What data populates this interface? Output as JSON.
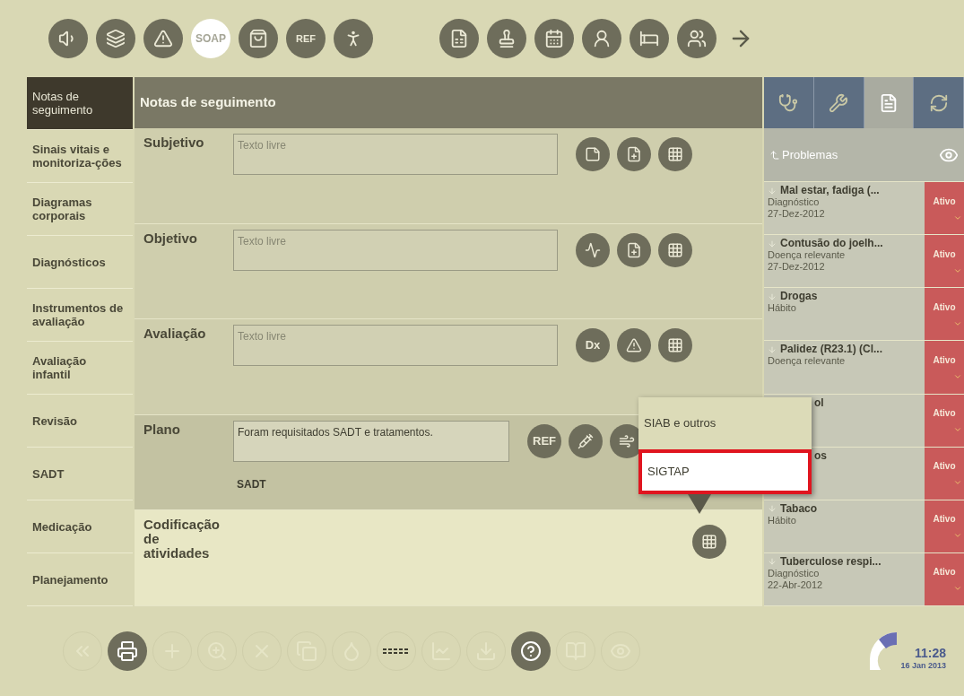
{
  "top_toolbar": [
    {
      "kind": "speaker",
      "selected": false
    },
    {
      "kind": "cards",
      "selected": false
    },
    {
      "kind": "warning",
      "selected": false
    },
    {
      "kind": "text",
      "label": "SOAP",
      "selected": true
    },
    {
      "kind": "bag",
      "selected": false
    },
    {
      "kind": "ref",
      "label": "REF",
      "selected": false
    },
    {
      "kind": "walker",
      "selected": false
    },
    {
      "kind": "gap"
    },
    {
      "kind": "sheet",
      "selected": false
    },
    {
      "kind": "stamp",
      "selected": false
    },
    {
      "kind": "calendar",
      "selected": false
    },
    {
      "kind": "nurse",
      "selected": false
    },
    {
      "kind": "bed",
      "selected": false
    },
    {
      "kind": "family",
      "selected": false
    },
    {
      "kind": "arrow"
    }
  ],
  "sidebar": {
    "items": [
      {
        "label": "Notas de seguimento",
        "selected": true
      },
      {
        "label": "Sinais vitais e monitoriza-ções",
        "selected": false
      },
      {
        "label": "Diagramas corporais",
        "selected": false
      },
      {
        "label": "Diagnósticos",
        "selected": false
      },
      {
        "label": "Instrumentos de avaliação",
        "selected": false
      },
      {
        "label": "Avaliação infantil",
        "selected": false
      },
      {
        "label": "Revisão",
        "selected": false
      },
      {
        "label": "SADT",
        "selected": false
      },
      {
        "label": "Medicação",
        "selected": false
      },
      {
        "label": "Planejamento",
        "selected": false
      }
    ]
  },
  "main": {
    "title": "Notas de seguimento",
    "sections": [
      {
        "label": "Subjetivo",
        "kind": "text",
        "field": {
          "placeholder": "Texto livre"
        },
        "actions": [
          {
            "kind": "note-plus"
          },
          {
            "kind": "file-plus"
          },
          {
            "kind": "grid-plus"
          }
        ]
      },
      {
        "label": "Objetivo",
        "kind": "text",
        "field": {
          "placeholder": "Texto livre"
        },
        "actions": [
          {
            "kind": "pulse-plus"
          },
          {
            "kind": "file-plus"
          },
          {
            "kind": "grid-plus"
          }
        ]
      },
      {
        "label": "Avaliação",
        "kind": "text",
        "field": {
          "placeholder": "Texto livre"
        },
        "actions": [
          {
            "kind": "label",
            "label": "Dx"
          },
          {
            "kind": "warning-plus"
          },
          {
            "kind": "grid-plus"
          }
        ]
      },
      {
        "label": "Plano",
        "kind": "plan",
        "field": {
          "value": "Foram requisitados SADT e tratamentos."
        },
        "note": "SADT",
        "actions": [
          {
            "kind": "ref",
            "label": "REF"
          },
          {
            "kind": "syringe-plus"
          },
          {
            "kind": "lungs"
          }
        ]
      },
      {
        "label": "Codificação de atividades",
        "kind": "coding",
        "actions": [
          {
            "kind": "grid-plus"
          }
        ]
      }
    ]
  },
  "popup_menu": {
    "items": [
      {
        "label": "SIAB e outros",
        "selected": false
      },
      {
        "label": "SIGTAP",
        "selected": true
      }
    ]
  },
  "right_panel": {
    "tabs": [
      {
        "kind": "doctor",
        "selected": false
      },
      {
        "kind": "wrench",
        "selected": false
      },
      {
        "kind": "file",
        "selected": true
      },
      {
        "kind": "refresh",
        "selected": false
      }
    ],
    "header": "Problemas",
    "problems": [
      {
        "kind": "entry",
        "title": "Mal estar, fadiga (...",
        "type": "Diagnóstico",
        "date": "27-Dez-2012",
        "status": "Ativo"
      },
      {
        "kind": "entry",
        "title": "Contusão do joelh...",
        "type": "Doença relevante",
        "date": "27-Dez-2012",
        "status": "Ativo"
      },
      {
        "kind": "entry",
        "title": "Drogas",
        "type": "Hábito",
        "status": "Ativo"
      },
      {
        "kind": "entry",
        "title": "Palidez (R23.1) (Cl...",
        "type": "Doença relevante",
        "status": "Ativo"
      },
      {
        "kind": "covered",
        "title": "ol",
        "status": "Ativo"
      },
      {
        "kind": "covered",
        "title": "os",
        "status": "Ativo"
      },
      {
        "kind": "entry",
        "title": "Tabaco",
        "type": "Hábito",
        "status": "Ativo"
      },
      {
        "kind": "entry",
        "title": "Tuberculose respi...",
        "type": "Diagnóstico",
        "date": "22-Abr-2012",
        "status": "Ativo"
      }
    ]
  },
  "bottom_toolbar": [
    {
      "kind": "back",
      "enabled": false
    },
    {
      "kind": "print",
      "enabled": true
    },
    {
      "kind": "plus",
      "enabled": false
    },
    {
      "kind": "zoom",
      "enabled": false
    },
    {
      "kind": "close",
      "enabled": false
    },
    {
      "kind": "copy",
      "enabled": false
    },
    {
      "kind": "dropper",
      "enabled": false
    },
    {
      "kind": "dashes",
      "enabled": false
    },
    {
      "kind": "chart",
      "enabled": false
    },
    {
      "kind": "download",
      "enabled": false
    },
    {
      "kind": "help",
      "enabled": true
    },
    {
      "kind": "book",
      "enabled": false
    },
    {
      "kind": "eye",
      "enabled": false
    }
  ],
  "clock": {
    "time": "11:28",
    "date": "16 Jan 2013"
  }
}
